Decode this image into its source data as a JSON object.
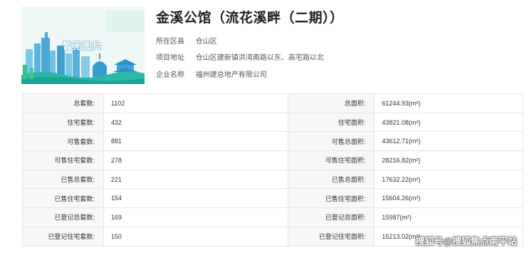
{
  "project": {
    "image_caption": "暂无图片",
    "title": "金溪公馆（流花溪畔（二期））",
    "info": [
      {
        "label": "所在区县",
        "value": "仓山区"
      },
      {
        "label": "项目地址",
        "value": "仓山区建新镇洪湾南路以东、高宅路以北"
      },
      {
        "label": "企业名称",
        "value": "福州建总地产有限公司"
      }
    ]
  },
  "stats": [
    {
      "left_label": "总套数:",
      "left_value": "1102",
      "right_label": "总面积:",
      "right_value": "61244.93(m²)"
    },
    {
      "left_label": "住宅套数:",
      "left_value": "432",
      "right_label": "住宅面积:",
      "right_value": "43821.08(m²)"
    },
    {
      "left_label": "可售套数:",
      "left_value": "881",
      "right_label": "可售总面积:",
      "right_value": "43612.71(m²)"
    },
    {
      "left_label": "可售住宅套数:",
      "left_value": "278",
      "right_label": "可售住宅面积:",
      "right_value": "28216.82(m²)"
    },
    {
      "left_label": "已售总套数:",
      "left_value": "221",
      "right_label": "已售总面积:",
      "right_value": "17632.22(m²)"
    },
    {
      "left_label": "已售住宅套数:",
      "left_value": "154",
      "right_label": "已售住宅面积:",
      "right_value": "15604.26(m²)"
    },
    {
      "left_label": "已登记总套数:",
      "left_value": "169",
      "right_label": "已登记总面积:",
      "right_value": "15987(m²)"
    },
    {
      "left_label": "已登记住宅套数:",
      "left_value": "150",
      "right_label": "已登记住宅面积:",
      "right_value": "15213.02(m²)"
    }
  ],
  "watermark": "搜狐号@搜狐焦点南平站",
  "colors": {
    "sky_blue": "#2e9bd6",
    "teal": "#29b7a8",
    "light_bg": "#e6f6f3"
  }
}
